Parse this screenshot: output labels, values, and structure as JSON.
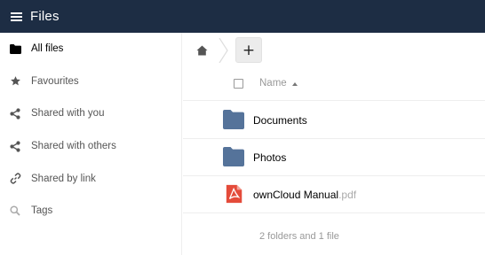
{
  "app": {
    "title": "Files"
  },
  "sidebar": {
    "items": [
      {
        "label": "All files",
        "icon": "folder-icon",
        "active": true
      },
      {
        "label": "Favourites",
        "icon": "star-icon"
      },
      {
        "label": "Shared with you",
        "icon": "share-icon"
      },
      {
        "label": "Shared with others",
        "icon": "share-icon"
      },
      {
        "label": "Shared by link",
        "icon": "link-icon"
      },
      {
        "label": "Tags",
        "icon": "search-icon"
      }
    ]
  },
  "toolbar": {
    "new_label": "+",
    "breadcrumb_home_icon": "home-icon"
  },
  "table": {
    "column_name": "Name",
    "sort": "ascending",
    "rows": [
      {
        "name": "Documents",
        "ext": "",
        "type": "folder",
        "icon": "folder-icon"
      },
      {
        "name": "Photos",
        "ext": "",
        "type": "folder",
        "icon": "folder-icon"
      },
      {
        "name": "ownCloud Manual",
        "ext": ".pdf",
        "type": "pdf",
        "icon": "pdf-icon"
      }
    ]
  },
  "summary": "2 folders and 1 file",
  "colors": {
    "header_bg": "#1d2d44",
    "folder": "#55739a",
    "pdf": "#e44b3a"
  }
}
